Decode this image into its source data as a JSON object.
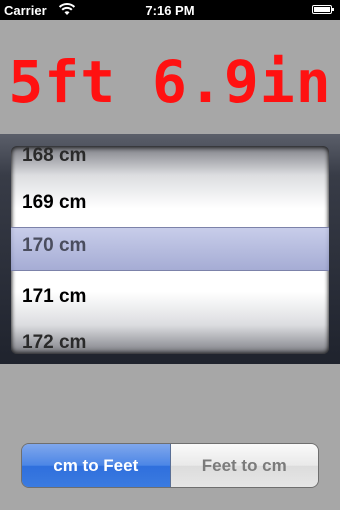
{
  "status_bar": {
    "carrier": "Carrier",
    "time": "7:16 PM",
    "wifi_icon": "wifi-icon",
    "battery_icon": "battery-icon"
  },
  "result": {
    "text": "5ft 6.9in",
    "color": "#ff1111"
  },
  "picker": {
    "rows": [
      "168 cm",
      "169 cm",
      "170 cm",
      "171 cm",
      "172 cm"
    ],
    "selected": "170 cm"
  },
  "segmented_control": {
    "options": [
      "cm to Feet",
      "Feet to cm"
    ],
    "selected_index": 0,
    "accent": "#3b7be0"
  }
}
